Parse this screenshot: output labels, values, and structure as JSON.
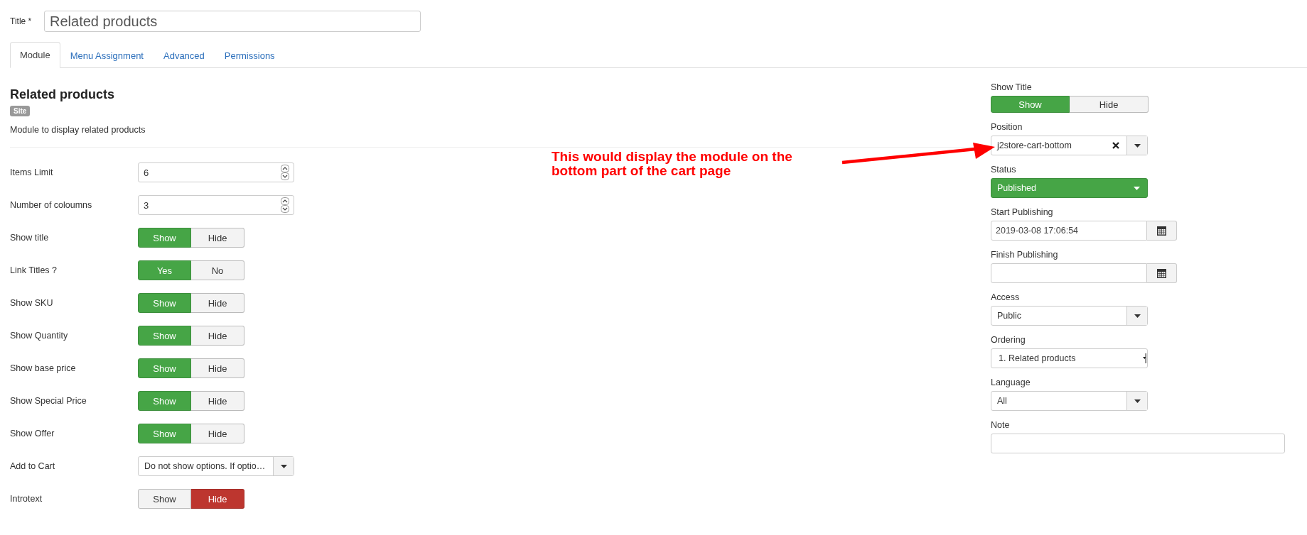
{
  "title_field": {
    "label": "Title *",
    "value": "Related products"
  },
  "tabs": [
    {
      "label": "Module",
      "selected": true
    },
    {
      "label": "Menu Assignment",
      "selected": false
    },
    {
      "label": "Advanced",
      "selected": false
    },
    {
      "label": "Permissions",
      "selected": false
    }
  ],
  "module": {
    "heading": "Related products",
    "badge": "Site",
    "description": "Module to display related products"
  },
  "options": [
    {
      "kind": "number",
      "label": "Items Limit",
      "value": "6"
    },
    {
      "kind": "number",
      "label": "Number of coloumns",
      "value": "3"
    },
    {
      "kind": "toggle",
      "label": "Show title",
      "choices": [
        {
          "label": "Show",
          "selected": true
        },
        {
          "label": "Hide",
          "selected": false
        }
      ]
    },
    {
      "kind": "toggle",
      "label": "Link Titles ?",
      "choices": [
        {
          "label": "Yes",
          "selected": true
        },
        {
          "label": "No",
          "selected": false
        }
      ]
    },
    {
      "kind": "toggle",
      "label": "Show SKU",
      "choices": [
        {
          "label": "Show",
          "selected": true
        },
        {
          "label": "Hide",
          "selected": false
        }
      ]
    },
    {
      "kind": "toggle",
      "label": "Show Quantity",
      "choices": [
        {
          "label": "Show",
          "selected": true
        },
        {
          "label": "Hide",
          "selected": false
        }
      ]
    },
    {
      "kind": "toggle",
      "label": "Show base price",
      "choices": [
        {
          "label": "Show",
          "selected": true
        },
        {
          "label": "Hide",
          "selected": false
        }
      ]
    },
    {
      "kind": "toggle",
      "label": "Show Special Price",
      "choices": [
        {
          "label": "Show",
          "selected": true
        },
        {
          "label": "Hide",
          "selected": false
        }
      ]
    },
    {
      "kind": "toggle",
      "label": "Show Offer",
      "choices": [
        {
          "label": "Show",
          "selected": true
        },
        {
          "label": "Hide",
          "selected": false
        }
      ]
    },
    {
      "kind": "select",
      "label": "Add to Cart",
      "value": "Do not show options. If optio…"
    },
    {
      "kind": "toggle",
      "label": "Introtext",
      "choices": [
        {
          "label": "Show",
          "selected": false
        },
        {
          "label": "Hide",
          "selected": true
        }
      ]
    }
  ],
  "annotation": {
    "text": "This would display the module on the\nbottom part of the cart page"
  },
  "sidebar": [
    {
      "kind": "toggle",
      "label": "Show Title",
      "choices": [
        {
          "label": "Show",
          "selected": true
        },
        {
          "label": "Hide",
          "selected": false
        }
      ]
    },
    {
      "kind": "clearable",
      "label": "Position",
      "value": "j2store-cart-bottom"
    },
    {
      "kind": "status",
      "label": "Status",
      "value": "Published"
    },
    {
      "kind": "date",
      "label": "Start Publishing",
      "value": "2019-03-08 17:06:54"
    },
    {
      "kind": "date",
      "label": "Finish Publishing"
    },
    {
      "kind": "select",
      "label": "Access",
      "value": "Public"
    },
    {
      "kind": "ordering",
      "label": "Ordering",
      "value": "1. Related products"
    },
    {
      "kind": "select",
      "label": "Language",
      "value": "All"
    },
    {
      "kind": "text",
      "label": "Note"
    }
  ]
}
